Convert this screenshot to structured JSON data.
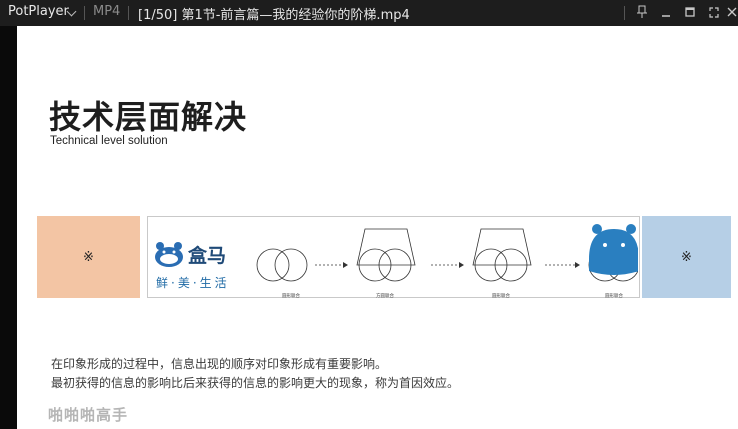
{
  "titlebar": {
    "app_name": "PotPlayer",
    "format": "MP4",
    "file_title": "[1/50] 第1节-前言篇—我的经验你的阶梯.mp4",
    "controls": [
      "pin-icon",
      "minimize-icon",
      "maximize-icon",
      "fullscreen-icon",
      "close-icon"
    ]
  },
  "slide": {
    "title": "技术层面解决",
    "subtitle": "Technical level solution",
    "placeholder_left": "※",
    "placeholder_right": "※",
    "logo": {
      "name": "盒马",
      "tagline": "鲜·美·生活"
    },
    "diagram_labels": [
      "圆形联合",
      "方圆联合",
      "圆形联合",
      "圆形联合"
    ],
    "body_lines": [
      "在印象形成的过程中，信息出现的顺序对印象形成有重要影响。",
      "最初获得的信息的影响比后来获得的信息的影响更大的现象，称为首因效应。"
    ],
    "watermark": "啪啪啪高手"
  },
  "colors": {
    "placeholder_left": "#f3c5a4",
    "placeholder_right": "#b6cfe6",
    "brand_blue": "#2a7fc0"
  }
}
